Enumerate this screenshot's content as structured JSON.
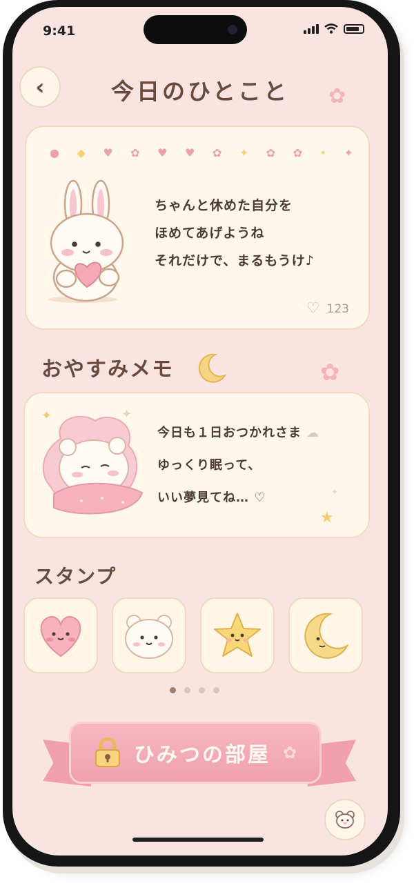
{
  "status_bar": {
    "time": "9:41"
  },
  "header": {
    "title": "今日のひとこと",
    "back_icon": "chevron-left-icon"
  },
  "daily_card": {
    "lines": [
      "ちゃんと休めた自分を",
      "ほめてあげようね",
      "それだけで、まるもうけ♪"
    ],
    "like_count": "123"
  },
  "sleep_section": {
    "title": "おやすみメモ",
    "lines": [
      "今日も１日おつかれさま",
      "ゆっくり眠って、",
      "いい夢見てね… ♡"
    ]
  },
  "stamps": {
    "title": "スタンプ",
    "items": [
      "heart-face-icon",
      "bear-face-icon",
      "star-face-icon",
      "crescent-moon-icon"
    ],
    "page_count": 4,
    "active_page": 1
  },
  "secret_room": {
    "label": "ひみつの部屋"
  },
  "colors": {
    "background": "#f9e4e2",
    "card": "#fff7e9",
    "text_brown": "#6b4a3e",
    "pink": "#ef9fad",
    "yellow": "#f2cd6f"
  }
}
